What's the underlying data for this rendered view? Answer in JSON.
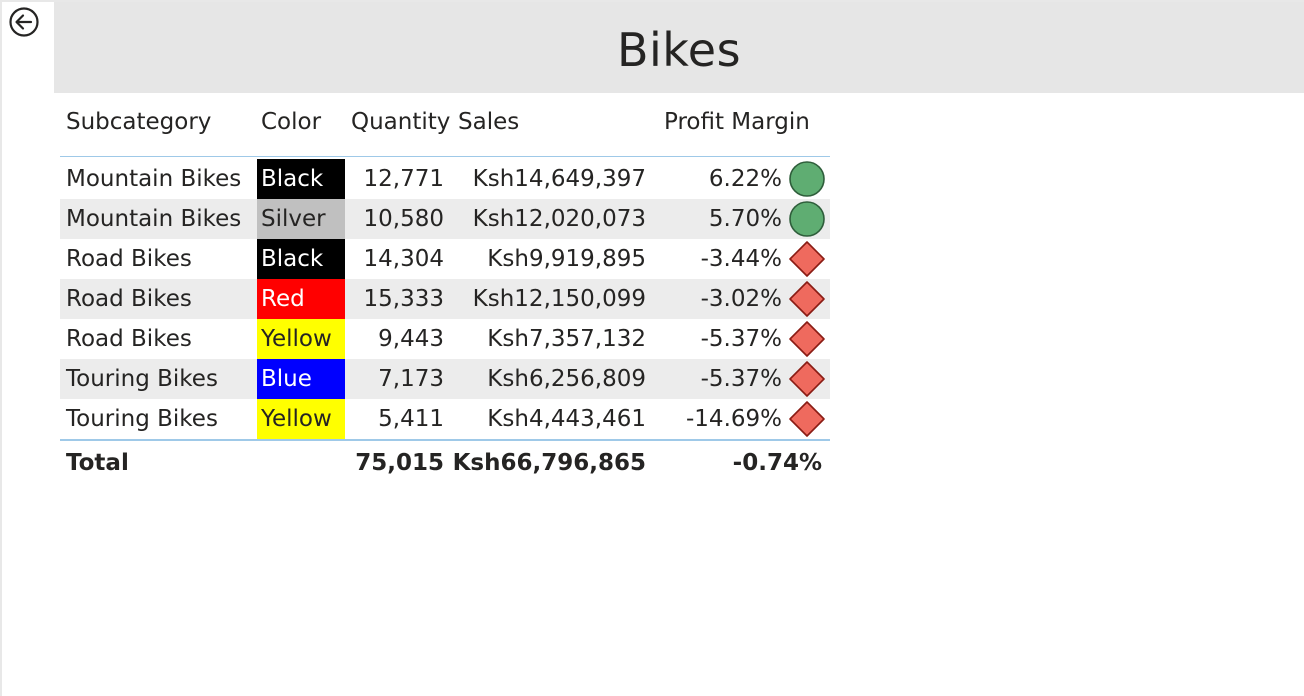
{
  "title": "Bikes",
  "nav": {
    "back_icon": "back-arrow-circle-icon"
  },
  "table": {
    "headers": {
      "subcategory": "Subcategory",
      "color": "Color",
      "quantity": "Quantity",
      "sales": "Sales",
      "profit_margin": "Profit Margin"
    },
    "rows": [
      {
        "subcategory": "Mountain Bikes",
        "color": "Black",
        "color_bg": "#000000",
        "color_fg": "#ffffff",
        "quantity": "12,771",
        "sales": "Ksh14,649,397",
        "profit_margin": "6.22%",
        "indicator": "green-circle"
      },
      {
        "subcategory": "Mountain Bikes",
        "color": "Silver",
        "color_bg": "#c0c0c0",
        "color_fg": "#252423",
        "quantity": "10,580",
        "sales": "Ksh12,020,073",
        "profit_margin": "5.70%",
        "indicator": "green-circle"
      },
      {
        "subcategory": "Road Bikes",
        "color": "Black",
        "color_bg": "#000000",
        "color_fg": "#ffffff",
        "quantity": "14,304",
        "sales": "Ksh9,919,895",
        "profit_margin": "-3.44%",
        "indicator": "red-diamond"
      },
      {
        "subcategory": "Road Bikes",
        "color": "Red",
        "color_bg": "#ff0000",
        "color_fg": "#ffffff",
        "quantity": "15,333",
        "sales": "Ksh12,150,099",
        "profit_margin": "-3.02%",
        "indicator": "red-diamond"
      },
      {
        "subcategory": "Road Bikes",
        "color": "Yellow",
        "color_bg": "#ffff00",
        "color_fg": "#252423",
        "quantity": "9,443",
        "sales": "Ksh7,357,132",
        "profit_margin": "-5.37%",
        "indicator": "red-diamond"
      },
      {
        "subcategory": "Touring Bikes",
        "color": "Blue",
        "color_bg": "#0000ff",
        "color_fg": "#ffffff",
        "quantity": "7,173",
        "sales": "Ksh6,256,809",
        "profit_margin": "-5.37%",
        "indicator": "red-diamond"
      },
      {
        "subcategory": "Touring Bikes",
        "color": "Yellow",
        "color_bg": "#ffff00",
        "color_fg": "#252423",
        "quantity": "5,411",
        "sales": "Ksh4,443,461",
        "profit_margin": "-14.69%",
        "indicator": "red-diamond"
      }
    ],
    "total": {
      "label": "Total",
      "quantity": "75,015",
      "sales": "Ksh66,796,865",
      "profit_margin": "-0.74%"
    }
  },
  "colors": {
    "title_bar_bg": "#e6e6e6",
    "kpi_good": "#5fad72",
    "kpi_bad": "#ef6a5e",
    "grid_line": "#9fc9e8"
  }
}
